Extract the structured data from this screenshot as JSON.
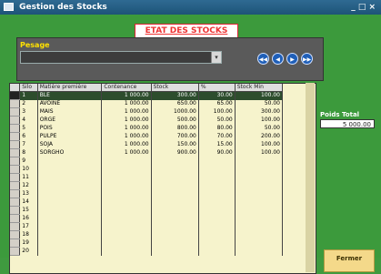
{
  "window": {
    "title": "Gestion des Stocks",
    "controls": "_ □ ×"
  },
  "header": {
    "title": "ETAT DES STOCKS"
  },
  "pesage": {
    "label": "Pesage",
    "value": ""
  },
  "nav": {
    "first": "◀◀",
    "prev": "◀",
    "next": "▶",
    "last": "▶▶"
  },
  "grid": {
    "columns": [
      "Silo",
      "Matière première",
      "Contenance",
      "Stock",
      "%",
      "Stock Min"
    ],
    "rows": [
      [
        "1",
        "BLE",
        "1 000.00",
        "300.00",
        "30.00",
        "100.00"
      ],
      [
        "2",
        "AVOINE",
        "1 000.00",
        "650.00",
        "65.00",
        "50.00"
      ],
      [
        "3",
        "MAIS",
        "1 000.00",
        "1000.00",
        "100.00",
        "300.00"
      ],
      [
        "4",
        "ORGE",
        "1 000.00",
        "500.00",
        "50.00",
        "100.00"
      ],
      [
        "5",
        "POIS",
        "1 000.00",
        "800.00",
        "80.00",
        "50.00"
      ],
      [
        "6",
        "PULPE",
        "1 000.00",
        "700.00",
        "70.00",
        "200.00"
      ],
      [
        "7",
        "SOJA",
        "1 000.00",
        "150.00",
        "15.00",
        "100.00"
      ],
      [
        "8",
        "SORGHO",
        "1 000.00",
        "900.00",
        "90.00",
        "100.00"
      ],
      [
        "9",
        "",
        "",
        "",
        "",
        ""
      ],
      [
        "10",
        "",
        "",
        "",
        "",
        ""
      ],
      [
        "11",
        "",
        "",
        "",
        "",
        ""
      ],
      [
        "12",
        "",
        "",
        "",
        "",
        ""
      ],
      [
        "13",
        "",
        "",
        "",
        "",
        ""
      ],
      [
        "14",
        "",
        "",
        "",
        "",
        ""
      ],
      [
        "15",
        "",
        "",
        "",
        "",
        ""
      ],
      [
        "16",
        "",
        "",
        "",
        "",
        ""
      ],
      [
        "17",
        "",
        "",
        "",
        "",
        ""
      ],
      [
        "18",
        "",
        "",
        "",
        "",
        ""
      ],
      [
        "19",
        "",
        "",
        "",
        "",
        ""
      ],
      [
        "20",
        "",
        "",
        "",
        "",
        ""
      ]
    ]
  },
  "totals": {
    "label": "Poids Total",
    "value": "5 000.00"
  },
  "buttons": {
    "fermer": "Fermer"
  }
}
